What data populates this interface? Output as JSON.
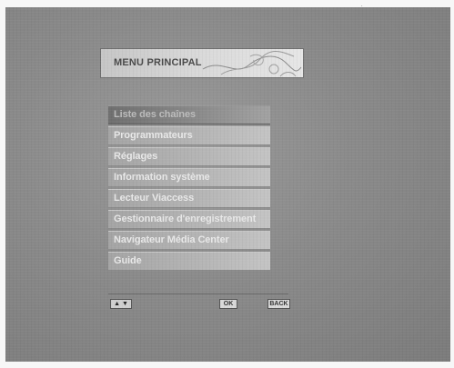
{
  "header": {
    "title": "MENU PRINCIPAL"
  },
  "menu": {
    "items": [
      {
        "label": "Liste des chaînes",
        "selected": true
      },
      {
        "label": "Programmateurs",
        "selected": false
      },
      {
        "label": "Réglages",
        "selected": false
      },
      {
        "label": "Information système",
        "selected": false
      },
      {
        "label": "Lecteur Viaccess",
        "selected": false
      },
      {
        "label": "Gestionnaire d'enregistrement",
        "selected": false
      },
      {
        "label": "Navigateur Média Center",
        "selected": false
      },
      {
        "label": "Guide",
        "selected": false
      }
    ]
  },
  "footer": {
    "nav_icons": [
      "arrow-up-icon",
      "arrow-down-icon"
    ],
    "ok_label": "OK",
    "back_label": "BACK"
  },
  "colors": {
    "background": "#8a8a8a",
    "item": "#b6b6b6",
    "item_selected": "#8a8a8a",
    "text": "#e9e9e9"
  }
}
